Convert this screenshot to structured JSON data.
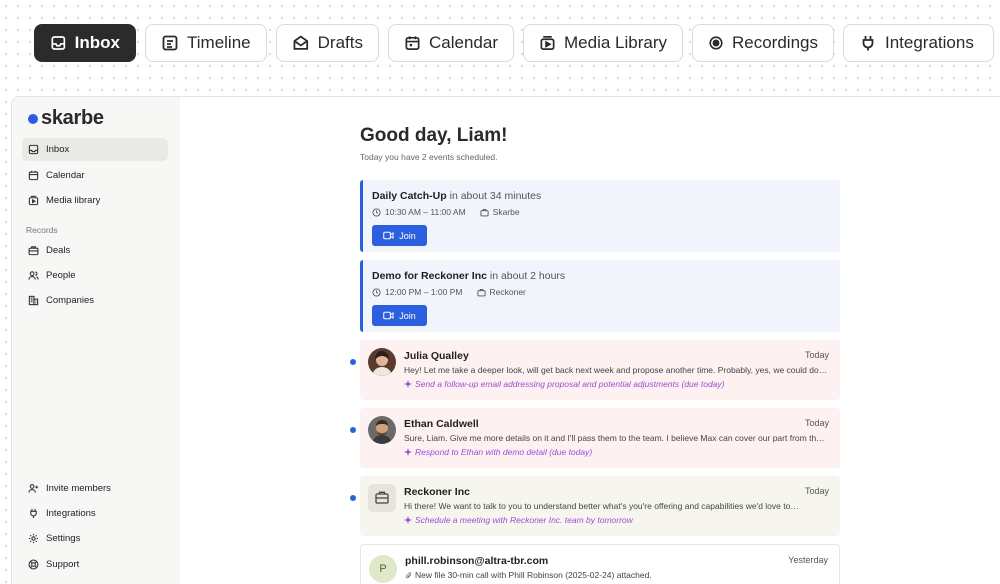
{
  "tabs": [
    {
      "label": "Inbox",
      "icon": "inbox-icon"
    },
    {
      "label": "Timeline",
      "icon": "timeline-icon"
    },
    {
      "label": "Drafts",
      "icon": "drafts-icon"
    },
    {
      "label": "Calendar",
      "icon": "calendar-icon"
    },
    {
      "label": "Media Library",
      "icon": "media-library-icon"
    },
    {
      "label": "Recordings",
      "icon": "record-icon"
    },
    {
      "label": "Integrations",
      "icon": "plug-icon"
    }
  ],
  "sidebar": {
    "brand": "skarbe",
    "items": [
      {
        "label": "Inbox",
        "icon": "inbox-icon"
      },
      {
        "label": "Calendar",
        "icon": "calendar-icon"
      },
      {
        "label": "Media library",
        "icon": "media-library-icon"
      }
    ],
    "records_label": "Records",
    "records": [
      {
        "label": "Deals",
        "icon": "briefcase-icon"
      },
      {
        "label": "People",
        "icon": "people-icon"
      },
      {
        "label": "Companies",
        "icon": "building-icon"
      }
    ],
    "footer": [
      {
        "label": "Invite members",
        "icon": "user-plus-icon"
      },
      {
        "label": "Integrations",
        "icon": "plug-icon"
      },
      {
        "label": "Settings",
        "icon": "gear-icon"
      },
      {
        "label": "Support",
        "icon": "lifebuoy-icon"
      }
    ]
  },
  "main": {
    "greeting": "Good day, Liam!",
    "subtitle": "Today you have 2 events scheduled.",
    "events": [
      {
        "title": "Daily Catch-Up",
        "relative": "in about 34 minutes",
        "time": "10:30 AM – 11:00 AM",
        "org": "Skarbe",
        "join_label": "Join"
      },
      {
        "title": "Demo for Reckoner Inc",
        "relative": "in about 2 hours",
        "time": "12:00 PM – 1:00 PM",
        "org": "Reckoner",
        "join_label": "Join"
      }
    ],
    "messages": [
      {
        "sender": "Julia Qualley",
        "when": "Today",
        "preview": "Hey! Let me take a deeper look, will get back next week and propose another time. Probably, yes, we could do it then.",
        "suggestion": "Send a follow-up email addressing proposal and potential adjustments (due today)"
      },
      {
        "sender": "Ethan Caldwell",
        "when": "Today",
        "preview": "Sure, Liam. Give me more details on it and I'll pass them to the team. I believe Max can cover our part from there.",
        "suggestion": "Respond to Ethan with demo detail (due today)"
      },
      {
        "sender": "Reckoner Inc",
        "when": "Today",
        "preview": "Hi there! We want to talk to you to understand better what's you're offering and capabilities we'd love to…",
        "suggestion": "Schedule a meeting with Reckoner Inc. team by tomorrow"
      },
      {
        "sender": "phill.robinson@altra-tbr.com",
        "when": "Yesterday",
        "preview": "New file 30-min call with Phill Robinson (2025-02-24) attached.",
        "avatar_letter": "P"
      }
    ]
  },
  "colors": {
    "accent": "#2c5fe0",
    "suggestion": "#9a4fd6",
    "active_tab": "#2b2b2b"
  }
}
